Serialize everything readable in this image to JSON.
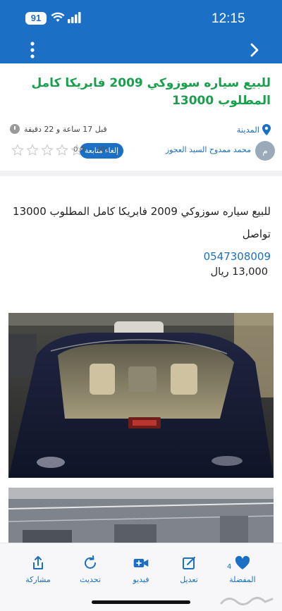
{
  "status_bar": {
    "battery": "91",
    "time": "12:15"
  },
  "post": {
    "title": "للبيع سياره سوزوكي 2009 فابريكا كامل المطلوب 13000",
    "city": "المدينة",
    "posted_ago": "قبل 17 ساعة و 22 دقيقة",
    "author": {
      "avatar_initial": "م",
      "name": "محمد ممدوح السيد العجوز",
      "follow_label": "إلغاء متابعة",
      "rating_count": "(0)",
      "rating_value": "0.0",
      "stars": 0
    },
    "body_line1": "للبيع سياره سوزوكي 2009 فابريكا كامل المطلوب 13000 تواصل",
    "phone": "0547308009",
    "price": "13,000 ريال"
  },
  "tabbar": {
    "items": [
      {
        "label": "مشاركة",
        "icon": "share-icon"
      },
      {
        "label": "تحديث",
        "icon": "refresh-icon"
      },
      {
        "label": "فيديو",
        "icon": "video-add-icon"
      },
      {
        "label": "تعديل",
        "icon": "edit-icon"
      },
      {
        "label": "المفضلة",
        "icon": "heart-icon",
        "badge": "4"
      }
    ]
  },
  "colors": {
    "brand": "#1b6fc4",
    "title_green": "#19a04d"
  }
}
